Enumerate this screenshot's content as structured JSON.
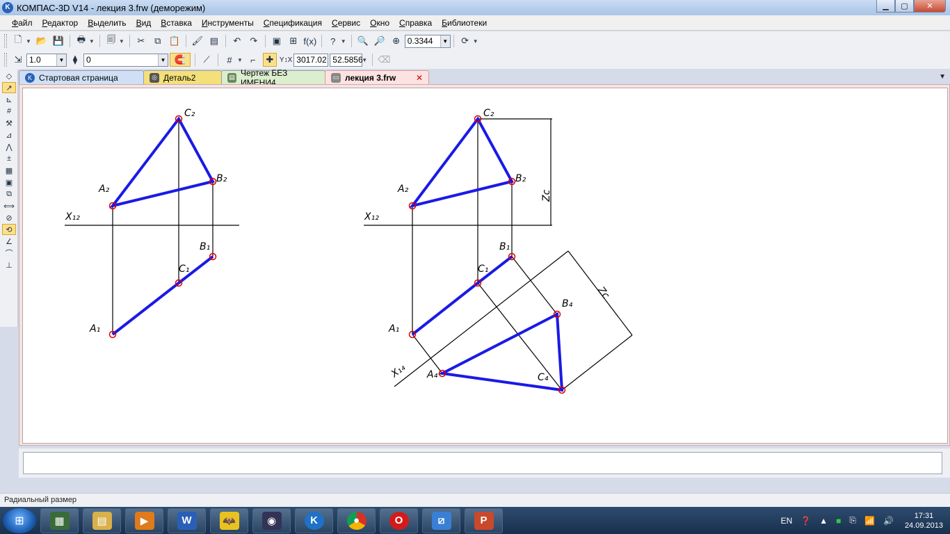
{
  "window": {
    "title": "КОМПАС-3D V14 - лекция 3.frw (деморежим)",
    "icon": "kompas-logo-icon"
  },
  "menu": [
    "Файл",
    "Редактор",
    "Выделить",
    "Вид",
    "Вставка",
    "Инструменты",
    "Спецификация",
    "Сервис",
    "Окно",
    "Справка",
    "Библиотеки"
  ],
  "toolbar": {
    "zoom_value": "0.3344"
  },
  "toolbar2": {
    "step_value": "1.0",
    "layer_value": "0",
    "coord_x": "3017.02",
    "coord_y": "52.5856"
  },
  "tabs": [
    {
      "label": "Стартовая страница",
      "color": "#cfe0f6"
    },
    {
      "label": "Деталь2",
      "color": "#f3e07a"
    },
    {
      "label": "Чертеж БЕЗ ИМЕНИ4",
      "color": "#dbeecd"
    },
    {
      "label": "лекция 3.frw",
      "color": "#fde2e2",
      "active": true
    }
  ],
  "drawing": {
    "labels": {
      "c2": "C₂",
      "a2": "A₂",
      "b2": "B₂",
      "x12": "X₁₂",
      "b1": "B₁",
      "c1": "C₁",
      "a1": "A₁",
      "c2r": "C₂",
      "a2r": "A₂",
      "b2r": "B₂",
      "x12r": "X₁₂",
      "b1r": "B₁",
      "c1r": "C₁",
      "a1r": "A₁",
      "zc1": "Zc",
      "zc2": "Zc",
      "b4": "B₄",
      "c4": "C₄",
      "a4": "A₄",
      "x14": "X₁₄"
    },
    "colors": {
      "triangle": "#1a1ae6",
      "point": "#e00000",
      "line": "#000000"
    }
  },
  "status": {
    "text": "Радиальный размер"
  },
  "taskbar": {
    "lang": "EN",
    "time": "17:31",
    "date": "24.09.2013"
  }
}
